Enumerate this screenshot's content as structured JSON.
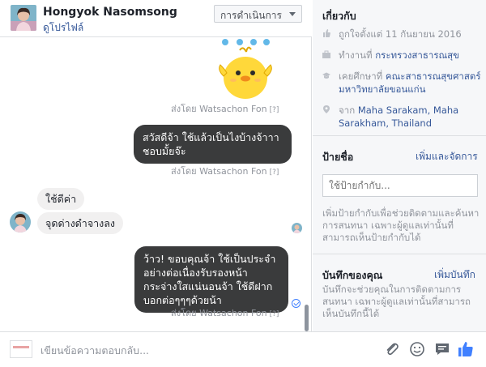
{
  "header": {
    "name": "Hongyok Nasomsong",
    "profile_link": "ดูโปรไฟล์",
    "actions_label": "การดำเนินการ"
  },
  "thread": {
    "messages": [
      {
        "type": "sticker",
        "meta": "ส่งโดย Watsachon Fon",
        "meta_q": "[?]"
      },
      {
        "type": "outgoing",
        "text": "สวัสดีจ้า ใช้แล้วเป็นไงบ้างจ้าาา ชอบมั้ยจ๊ะ",
        "meta": "ส่งโดย Watsachon Fon",
        "meta_q": "[?]"
      },
      {
        "type": "incoming",
        "text": "ใช้ดีค่า"
      },
      {
        "type": "incoming",
        "text": "จุดด่างดำจางลง"
      },
      {
        "type": "outgoing",
        "text": "ว้าว! ขอบคุณจ้า ใช้เป็นประจำอย่างต่อเนื่องรับรองหน้ากระจ่างใสแน่นอนจ้า ใช้ดีฝากบอกต่อๆๆๆด้วยน้า",
        "meta": "ส่งโดย Watsachon Fon",
        "meta_q": "[?]"
      }
    ]
  },
  "composer": {
    "placeholder": "เขียนข้อความตอบกลับ..."
  },
  "info": {
    "about": {
      "title": "เกี่ยวกับ",
      "likes_since": "ถูกใจตั้งแต่ 11 กันยายน 2016",
      "works_prefix": "ทำงานที่",
      "works_at": "กระทรวงสาธารณสุข",
      "studied_prefix": "เคยศึกษาที่",
      "studied_at": "คณะสาธารณสุขศาสตร์ มหาวิทยาลัยขอนแก่น",
      "from_prefix": "จาก",
      "from_place": "Maha Sarakam, Maha Sarakham, Thailand"
    },
    "labels": {
      "title": "ป้ายชื่อ",
      "action": "เพิ่มและจัดการ",
      "input_placeholder": "ใช้ป้ายกำกับ...",
      "help": "เพิ่มป้ายกำกับเพื่อช่วยติดตามและค้นหาการสนทนา เฉพาะผู้ดูแลเท่านั้นที่สามารถเห็นป้ายกำกับได้"
    },
    "notes": {
      "title": "บันทึกของคุณ",
      "action": "เพิ่มบันทึก",
      "help": "บันทึกจะช่วยคุณในการติดตามการสนทนา เฉพาะผู้ดูแลเท่านั้นที่สามารถเห็นบันทึกนี้ได้"
    }
  },
  "colors": {
    "link": "#365899",
    "outgoing_bubble": "#3a3b3c",
    "incoming_bubble": "#f1f0f0",
    "like_blue": "#4080ff"
  }
}
